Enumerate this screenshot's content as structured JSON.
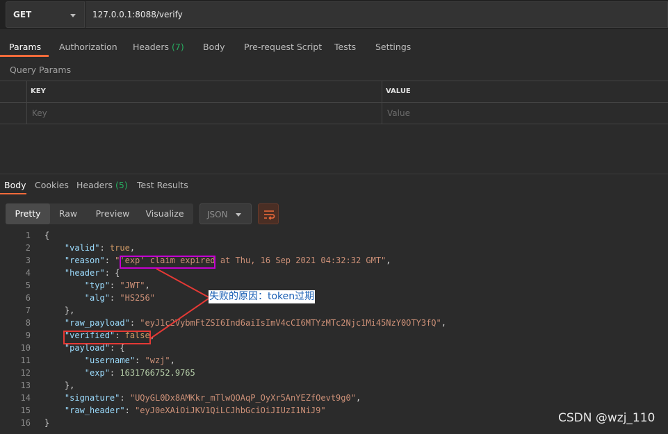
{
  "request": {
    "method": "GET",
    "url": "127.0.0.1:8088/verify"
  },
  "request_tabs": [
    {
      "label": "Params"
    },
    {
      "label": "Authorization"
    },
    {
      "label": "Headers",
      "count": "(7)"
    },
    {
      "label": "Body"
    },
    {
      "label": "Pre-request Script"
    },
    {
      "label": "Tests"
    },
    {
      "label": "Settings"
    }
  ],
  "query_params": {
    "title": "Query Params",
    "key_header": "KEY",
    "value_header": "VALUE",
    "key_placeholder": "Key",
    "value_placeholder": "Value"
  },
  "response_tabs": [
    {
      "label": "Body"
    },
    {
      "label": "Cookies"
    },
    {
      "label": "Headers",
      "count": "(5)"
    },
    {
      "label": "Test Results"
    }
  ],
  "format_buttons": [
    "Pretty",
    "Raw",
    "Preview",
    "Visualize"
  ],
  "format_select": "JSON",
  "code_lines": [
    "1",
    "2",
    "3",
    "4",
    "5",
    "6",
    "7",
    "8",
    "9",
    "10",
    "11",
    "12",
    "13",
    "14",
    "15",
    "16"
  ],
  "json": {
    "valid_key": "\"valid\"",
    "valid_val": "true",
    "reason_key": "\"reason\"",
    "reason_val": "\"'exp' claim expired at Thu, 16 Sep 2021 04:32:32 GMT\"",
    "header_key": "\"header\"",
    "typ_key": "\"typ\"",
    "typ_val": "\"JWT\"",
    "alg_key": "\"alg\"",
    "alg_val": "\"HS256\"",
    "raw_payload_key": "\"raw_payload\"",
    "raw_payload_val": "\"eyJ1c2VybmFtZSI6Ind6aiIsImV4cCI6MTYzMTc2Njc1Mi45NzY0OTY3fQ\"",
    "verified_key": "\"verified\"",
    "verified_val": "false",
    "payload_key": "\"payload\"",
    "username_key": "\"username\"",
    "username_val": "\"wzj\"",
    "exp_key": "\"exp\"",
    "exp_val": "1631766752.9765",
    "signature_key": "\"signature\"",
    "signature_val": "\"UQyGL0Dx8AMKkr_mTlwQOAqP_OyXr5AnYEZfOevt9g0\"",
    "raw_header_key": "\"raw_header\"",
    "raw_header_val": "\"eyJ0eXAiOiJKV1QiLCJhbGciOiJIUzI1NiJ9\""
  },
  "annotation": "失败的原因：token过期",
  "watermark": "CSDN @wzj_110",
  "colors": {
    "accent": "#f26b3a",
    "count_green": "#27ae60",
    "highlight_purple": "#c400d1",
    "highlight_red": "#e53935"
  }
}
